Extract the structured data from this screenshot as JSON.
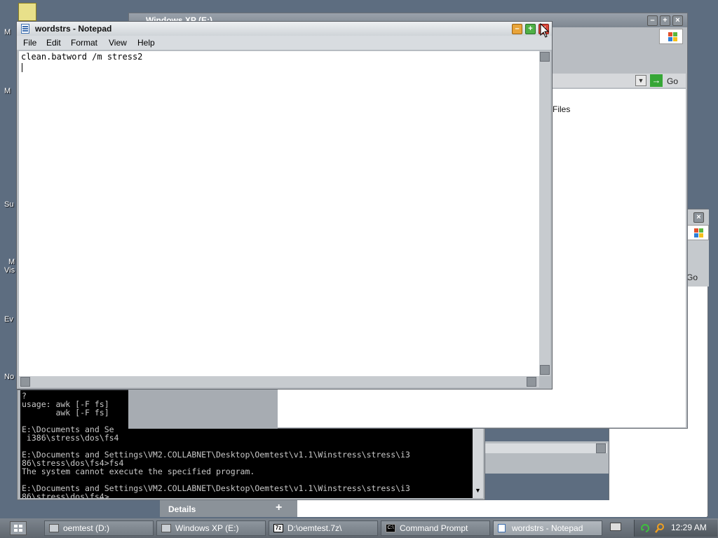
{
  "desktop": {
    "labels": [
      "M",
      "M",
      "Su",
      "M",
      "Vis",
      "Ev",
      "No"
    ]
  },
  "explorer": {
    "title": "Windows XP (E:)",
    "go_label": "Go",
    "files_text": "Files"
  },
  "explorer2": {
    "go_label": "Go"
  },
  "notepad": {
    "title": "wordstrs - Notepad",
    "menu": [
      "File",
      "Edit",
      "Format",
      "View",
      "Help"
    ],
    "text": "clean.batword /m stress2"
  },
  "cmd": {
    "lines": [
      "?",
      "usage: awk [-F fs]",
      "       awk [-F fs]",
      "",
      "E:\\Documents and Se",
      " i386\\stress\\dos\\fs4",
      "",
      "E:\\Documents and Settings\\VM2.COLLABNET\\Desktop\\Oemtest\\v1.1\\Winstress\\stress\\i3",
      "86\\stress\\dos\\fs4>fs4",
      "The system cannot execute the specified program.",
      "",
      "E:\\Documents and Settings\\VM2.COLLABNET\\Desktop\\Oemtest\\v1.1\\Winstress\\stress\\i3",
      "86\\stress\\dos\\fs4>"
    ]
  },
  "details": {
    "label": "Details",
    "expand": "+"
  },
  "taskbar": {
    "tasks": [
      {
        "label": "oemtest (D:)",
        "icon": "drive-icon"
      },
      {
        "label": "Windows XP (E:)",
        "icon": "drive-icon"
      },
      {
        "label": "D:\\oemtest.7z\\",
        "icon": "7zip-icon"
      },
      {
        "label": "Command Prompt",
        "icon": "cmd-icon"
      },
      {
        "label": "wordstrs - Notepad",
        "icon": "notepad-icon"
      }
    ],
    "clock": "12:29 AM"
  }
}
